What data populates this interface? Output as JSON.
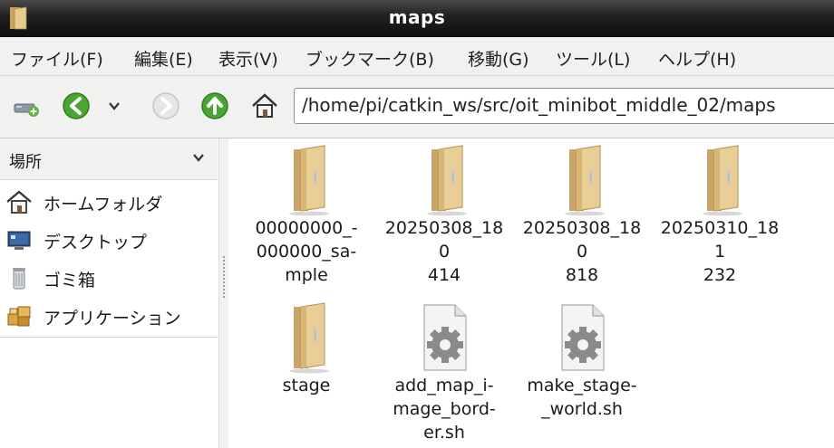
{
  "window": {
    "title": "maps",
    "app_icon": "folder-icon"
  },
  "menubar": {
    "items": [
      {
        "label": "ファイル(F)",
        "name": "menu-file"
      },
      {
        "label": "編集(E)",
        "name": "menu-edit"
      },
      {
        "label": "表示(V)",
        "name": "menu-view"
      },
      {
        "label": "ブックマーク(B)",
        "name": "menu-bookmarks"
      },
      {
        "label": "移動(G)",
        "name": "menu-go"
      },
      {
        "label": "ツール(L)",
        "name": "menu-tools"
      },
      {
        "label": "ヘルプ(H)",
        "name": "menu-help"
      }
    ]
  },
  "toolbar": {
    "new_tab_icon": "new-tab-icon",
    "back_icon": "back-arrow-icon",
    "history_icon": "chevron-down-icon",
    "forward_icon": "forward-arrow-icon",
    "up_icon": "up-arrow-icon",
    "home_icon": "home-icon",
    "address": "/home/pi/catkin_ws/src/oit_minibot_middle_02/maps"
  },
  "sidebar": {
    "header": "場所",
    "items": [
      {
        "label": "ホームフォルダ",
        "icon": "home-icon"
      },
      {
        "label": "デスクトップ",
        "icon": "desktop-icon"
      },
      {
        "label": "ゴミ箱",
        "icon": "trash-icon"
      },
      {
        "label": "アプリケーション",
        "icon": "applications-icon"
      }
    ]
  },
  "files": [
    {
      "name": "00000000_-000000_sample",
      "display": [
        "00000000_-",
        "000000_sa-",
        "mple"
      ],
      "type": "folder"
    },
    {
      "name": "20250308_180414",
      "display": [
        "20250308_180",
        "414"
      ],
      "type": "folder"
    },
    {
      "name": "20250308_180818",
      "display": [
        "20250308_180",
        "818"
      ],
      "type": "folder"
    },
    {
      "name": "20250310_181232",
      "display": [
        "20250310_181",
        "232"
      ],
      "type": "folder"
    },
    {
      "name": "stage",
      "display": [
        "stage"
      ],
      "type": "folder"
    },
    {
      "name": "add_map_image_border.sh",
      "display": [
        "add_map_i-",
        "mage_bord-",
        "er.sh"
      ],
      "type": "script"
    },
    {
      "name": "make_stage-_world.sh",
      "display": [
        "make_stage-",
        "_world.sh"
      ],
      "type": "script"
    }
  ],
  "colors": {
    "titlebar": "#1f1f1f",
    "folder": "#d9b878",
    "back_green": "#4aa531",
    "chrome_bg": "#f1f1f0"
  }
}
